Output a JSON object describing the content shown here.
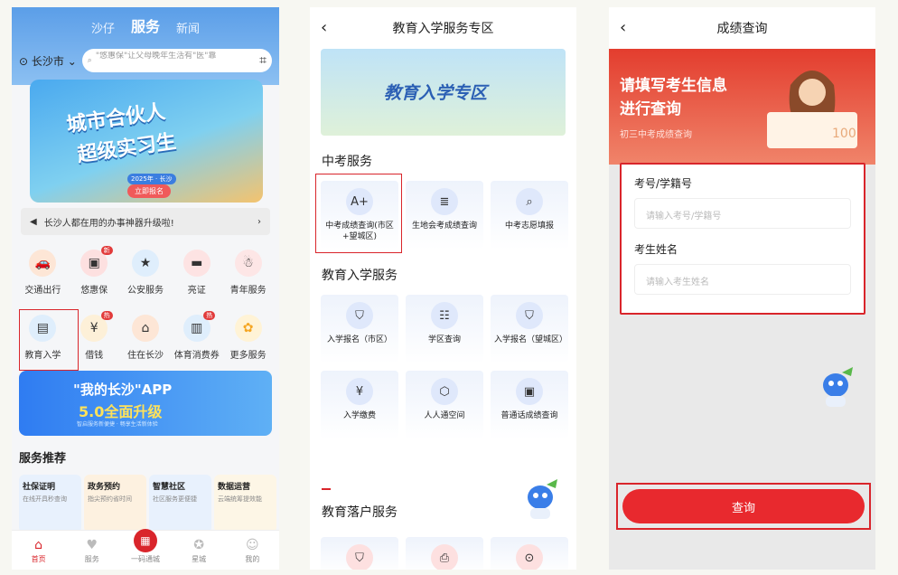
{
  "panel1": {
    "tabs": [
      "沙仔",
      "服务",
      "新闻"
    ],
    "location": "长沙市",
    "search_placeholder": "\"悠惠保\"让父母晚年生活有\"医\"靠",
    "banner": {
      "line1": "城市合伙人",
      "line2": "超级实习生",
      "year": "2025年 · 长沙",
      "cta": "立即报名"
    },
    "notice": "长沙人都在用的办事神器升级啦!",
    "grid_row1": [
      {
        "label": "交通出行",
        "icon": "car-icon"
      },
      {
        "label": "悠惠保",
        "icon": "insurance-icon",
        "badge": "新"
      },
      {
        "label": "公安服务",
        "icon": "police-icon"
      },
      {
        "label": "亮证",
        "icon": "id-card-icon"
      },
      {
        "label": "青年服务",
        "icon": "youth-icon"
      }
    ],
    "grid_row2": [
      {
        "label": "教育入学",
        "icon": "education-icon"
      },
      {
        "label": "借钱",
        "icon": "money-icon",
        "badge": "热"
      },
      {
        "label": "住在长沙",
        "icon": "house-icon"
      },
      {
        "label": "体育消费券",
        "icon": "sports-icon",
        "badge": "热"
      },
      {
        "label": "更多服务",
        "icon": "more-icon"
      }
    ],
    "app_banner": {
      "line1": "\"我的长沙\"APP",
      "line2": "5.0全面升级",
      "sub": "智启服务新便捷 · 畅享生活新体验"
    },
    "recommend_title": "服务推荐",
    "cards": [
      {
        "title": "社保证明",
        "sub": "在线开具秒查询"
      },
      {
        "title": "政务预约",
        "sub": "指尖预约省时间"
      },
      {
        "title": "智慧社区",
        "sub": "社区服务更便捷"
      },
      {
        "title": "数据运营",
        "sub": "云端统筹提效能"
      }
    ],
    "tabbar": [
      {
        "label": "首页",
        "icon": "home-icon"
      },
      {
        "label": "服务",
        "icon": "heart-icon"
      },
      {
        "label": "一码通城",
        "icon": "qr-icon"
      },
      {
        "label": "星城",
        "icon": "star-icon"
      },
      {
        "label": "我的",
        "icon": "user-icon"
      }
    ]
  },
  "panel2": {
    "title": "教育入学服务专区",
    "banner_text": "教育入学专区",
    "section1": "中考服务",
    "section1_items": [
      {
        "label": "中考成绩查询(市区+望城区)",
        "icon": "A+"
      },
      {
        "label": "生地会考成绩查询",
        "icon": "≣"
      },
      {
        "label": "中考志愿填报",
        "icon": "⌕"
      }
    ],
    "section2": "教育入学服务",
    "section2_items": [
      {
        "label": "入学报名（市区）",
        "icon": "⛉"
      },
      {
        "label": "学区查询",
        "icon": "☷"
      },
      {
        "label": "入学报名（望城区）",
        "icon": "⛉"
      },
      {
        "label": "入学缴费",
        "icon": "¥"
      },
      {
        "label": "人人通空间",
        "icon": "⬡"
      },
      {
        "label": "普通话成绩查询",
        "icon": "▣"
      }
    ],
    "section3": "教育落户服务"
  },
  "panel3": {
    "title": "成绩查询",
    "heading1": "请填写考生信息",
    "heading2": "进行查询",
    "subheading": "初三中考成绩查询",
    "score_card": "100",
    "field1_label": "考号/学籍号",
    "field1_placeholder": "请输入考号/学籍号",
    "field2_label": "考生姓名",
    "field2_placeholder": "请输入考生姓名",
    "submit": "查询"
  },
  "colors": {
    "brand_red": "#d9252b",
    "blue": "#5b9ee8"
  }
}
